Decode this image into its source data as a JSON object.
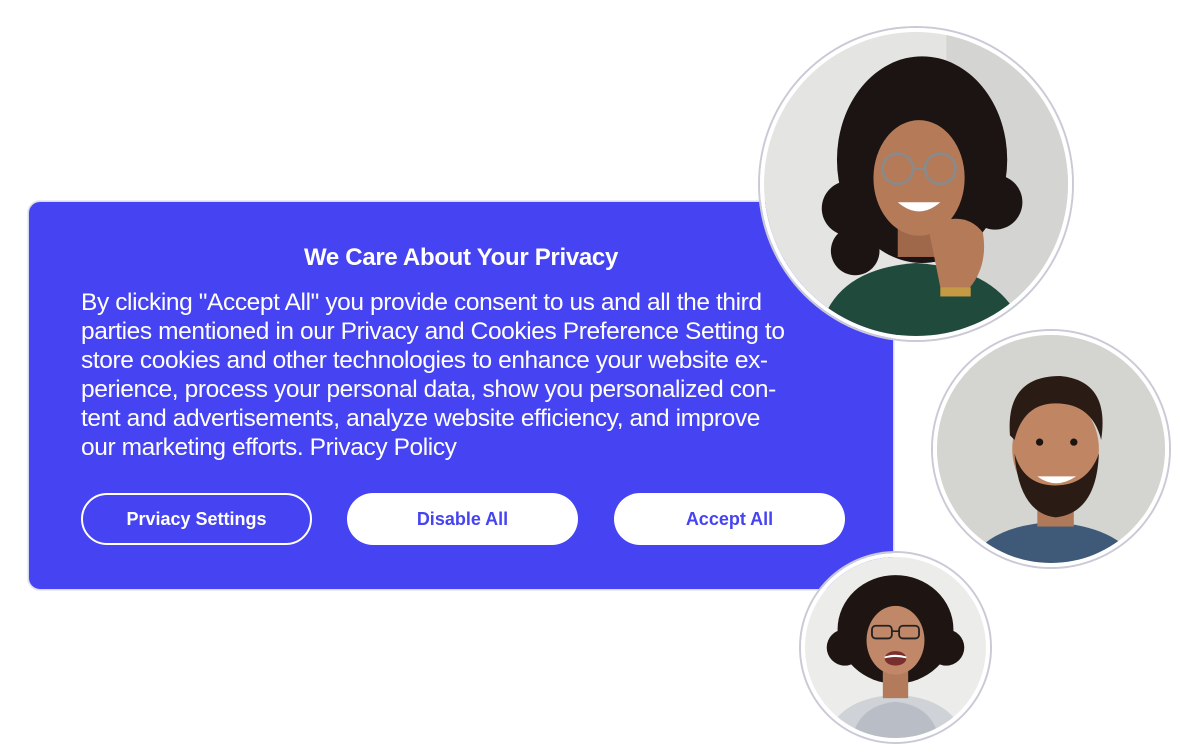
{
  "banner": {
    "title": "We Care About Your Privacy",
    "body": "By clicking \"Accept All\" you provide consent to us and all the third\nparties mentioned in our Privacy and Cookies Preference Setting to\nstore cookies and other technologies to enhance your website ex-\nperience, process your personal data, show you personalized con-\ntent and advertisements, analyze website efficiency, and improve\nour marketing efforts. Privacy Policy",
    "buttons": {
      "settings": "Prviacy Settings",
      "disable": "Disable All",
      "accept": "Accept All"
    },
    "colors": {
      "accent": "#4543f2",
      "text": "#ffffff"
    }
  },
  "avatars": [
    {
      "icon": "woman-with-curly-hair-and-glasses-photo"
    },
    {
      "icon": "smiling-bearded-man-photo"
    },
    {
      "icon": "laughing-woman-with-glasses-photo"
    }
  ]
}
